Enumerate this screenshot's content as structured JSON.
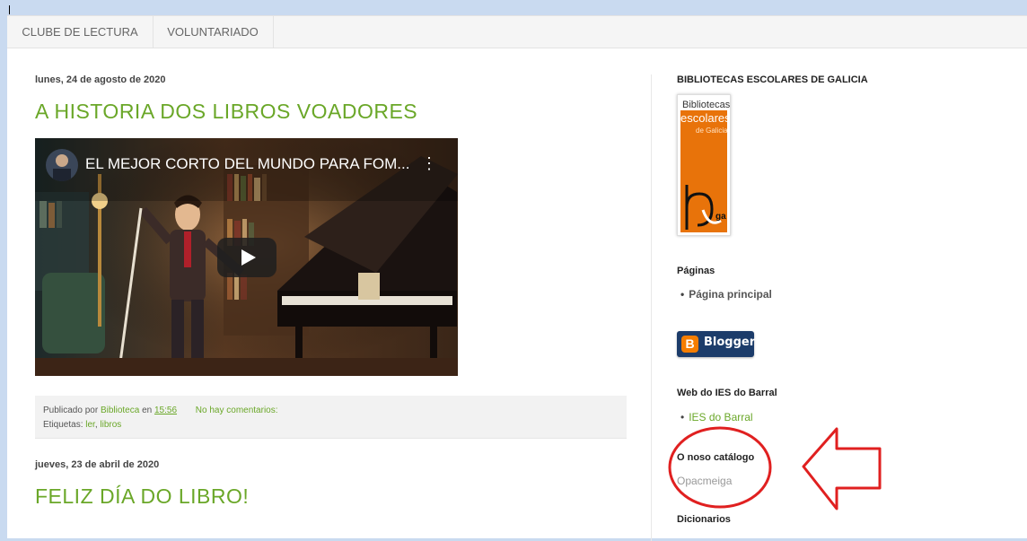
{
  "nav": {
    "tabs": [
      "CLUBE DE LECTURA",
      "VOLUNTARIADO"
    ]
  },
  "posts": [
    {
      "date": "lunes, 24 de agosto de 2020",
      "title": "A HISTORIA DOS LIBROS VOADORES",
      "video_title": "EL MEJOR CORTO DEL MUNDO PARA FOM...",
      "footer": {
        "published_by_label": "Publicado por",
        "author": "Biblioteca",
        "at_label": "en",
        "time": "15:56",
        "comments": "No hay comentarios:",
        "tags_label": "Etiquetas:",
        "tag1": "ler",
        "tag_sep": ",",
        "tag2": "libros"
      }
    },
    {
      "date": "jueves, 23 de abril de 2020",
      "title": "FELIZ DÍA DO LIBRO!"
    }
  ],
  "sidebar": {
    "bega_title": "BIBLIOTECAS ESCOLARES DE GALICIA",
    "bega_logo": {
      "line1": "Bibliotecas",
      "line2": "escolares",
      "line3": "de Galicia",
      "mark": "ga"
    },
    "pages_title": "Páginas",
    "pages_item": "Página principal",
    "blogger_label": "Blogger",
    "web_title": "Web do IES do Barral",
    "web_item": "IES do Barral",
    "catalog_title": "O noso catálogo",
    "catalog_link": "Opacmeiga",
    "dict_title": "Dicionarios"
  },
  "colors": {
    "link_green": "#6aa728",
    "annotation_red": "#e02020",
    "blogger_navy": "#1c3c6a",
    "bega_orange": "#e8730a"
  }
}
